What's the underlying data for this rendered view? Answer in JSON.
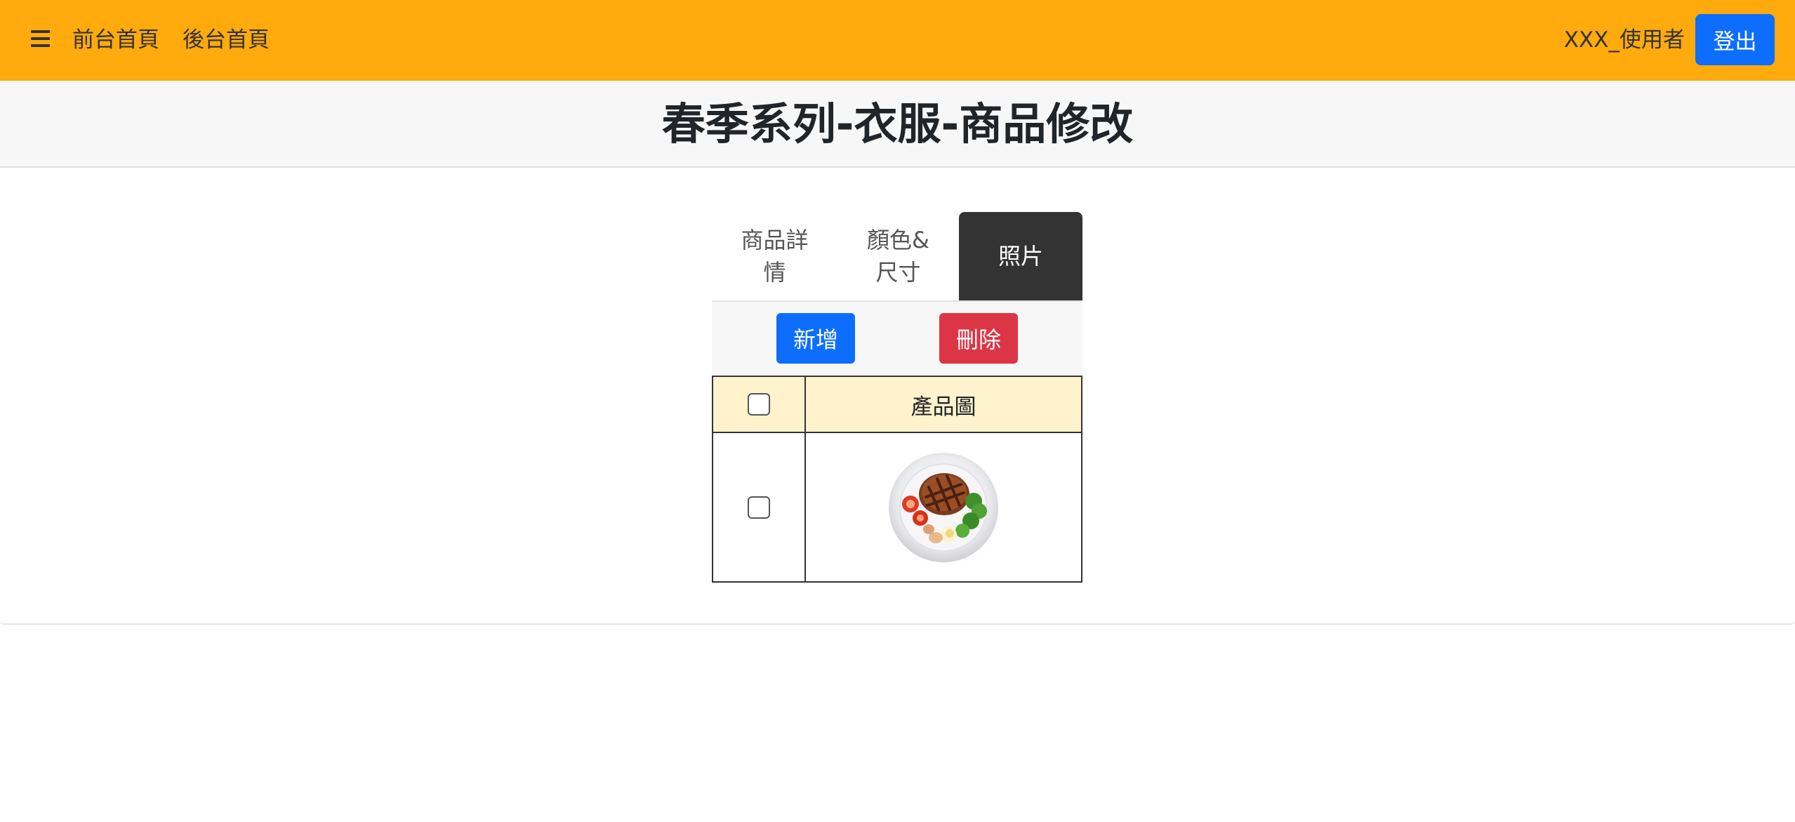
{
  "navbar": {
    "menu_icon": "hamburger-icon",
    "front_home": "前台首頁",
    "back_home": "後台首頁",
    "username": "XXX_使用者",
    "logout": "登出",
    "bg_color": "#ffaa0d"
  },
  "page": {
    "title": "春季系列-衣服-商品修改"
  },
  "tabs": [
    {
      "label_line1": "商品詳",
      "label_line2": "情",
      "active": false
    },
    {
      "label_line1": "顏色&",
      "label_line2": "尺寸",
      "active": false
    },
    {
      "label_line1": "照片",
      "label_line2": "",
      "active": true
    }
  ],
  "actions": {
    "add": "新增",
    "delete": "刪除",
    "add_color": "#0d6efd",
    "delete_color": "#dc3545"
  },
  "table": {
    "header_image": "產品圖",
    "rows": [
      {
        "checked": false,
        "image": "steak-plate-photo"
      }
    ]
  }
}
